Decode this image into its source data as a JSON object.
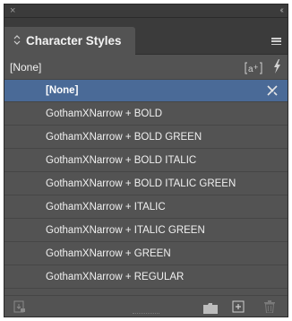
{
  "panel": {
    "title": "Character Styles",
    "tab_chevron": "↕",
    "titlebar_collapse": "‹‹",
    "titlebar_close": "×"
  },
  "current_style": "[None]",
  "override_icon_label": "[a+]",
  "lightning_icon_label": "ϟ",
  "styles": [
    {
      "label": "[None]",
      "selected": true
    },
    {
      "label": "GothamXNarrow + BOLD"
    },
    {
      "label": "GothamXNarrow + BOLD GREEN"
    },
    {
      "label": "GothamXNarrow + BOLD ITALIC"
    },
    {
      "label": "GothamXNarrow + BOLD ITALIC GREEN"
    },
    {
      "label": "GothamXNarrow + ITALIC"
    },
    {
      "label": "GothamXNarrow + ITALIC GREEN"
    },
    {
      "label": "GothamXNarrow + GREEN"
    },
    {
      "label": "GothamXNarrow + REGULAR"
    }
  ],
  "icons": {
    "close": "close-icon",
    "collapse": "collapse-panel-icon",
    "panel_menu": "hamburger-menu-icon",
    "lock": "locked-icon",
    "load": "load-styles-icon",
    "folder": "folder-icon",
    "new": "new-style-icon",
    "trash": "trash-icon"
  },
  "colors": {
    "panel_bg": "#535353",
    "titlebar_bg": "#3b3b3b",
    "selection": "#4a6a97",
    "text": "#f0f0f0"
  }
}
